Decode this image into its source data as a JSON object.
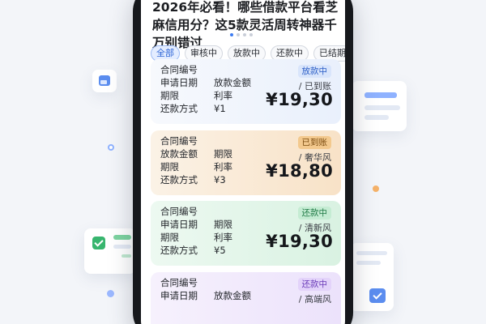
{
  "article": {
    "title": "2026年必看！哪些借款平台看芝麻信用分？这5款灵活周转神器千万别错过"
  },
  "carousel": {
    "count": 4,
    "active_index": 0
  },
  "tabs": [
    {
      "label": "全部",
      "active": true
    },
    {
      "label": "审核中",
      "active": false
    },
    {
      "label": "放款中",
      "active": false
    },
    {
      "label": "还款中",
      "active": false
    },
    {
      "label": "已结期",
      "active": false
    }
  ],
  "cards": [
    {
      "theme": "blue",
      "rows": [
        [
          "合同编号",
          ""
        ],
        [
          "申请日期",
          "放款金额"
        ],
        [
          "期限",
          "利率"
        ],
        [
          "还款方式",
          "¥1"
        ]
      ],
      "badge": "放款中",
      "subtitle": "/ 已到账",
      "amount": "¥19,30"
    },
    {
      "theme": "orange",
      "rows": [
        [
          "合同编号",
          ""
        ],
        [
          "放款金额",
          "期限"
        ],
        [
          "期限",
          "利率"
        ],
        [
          "还款方式",
          "¥3"
        ]
      ],
      "badge": "已到账",
      "subtitle": "/ 奢华风",
      "amount": "¥18,80"
    },
    {
      "theme": "green",
      "rows": [
        [
          "合同编号",
          ""
        ],
        [
          "申请日期",
          "期限"
        ],
        [
          "期限",
          "利率"
        ],
        [
          "还款方式",
          "¥5"
        ]
      ],
      "badge": "还款中",
      "subtitle": "/ 清新风",
      "amount": "¥19,30"
    },
    {
      "theme": "purple",
      "rows": [
        [
          "合同编号",
          ""
        ],
        [
          "申请日期",
          "放款金额"
        ]
      ],
      "badge": "还款中",
      "subtitle": "/ 高端风",
      "amount": ""
    }
  ],
  "colors": {
    "accent": "#3d7cf2",
    "blue_badge": "#d9e5fb",
    "orange_badge": "#f3c98e",
    "green_badge": "#c5ecd3",
    "purple_badge": "#e3d3fa"
  },
  "icons": [
    "image-icon",
    "checkbox-icon",
    "check-button-icon"
  ]
}
